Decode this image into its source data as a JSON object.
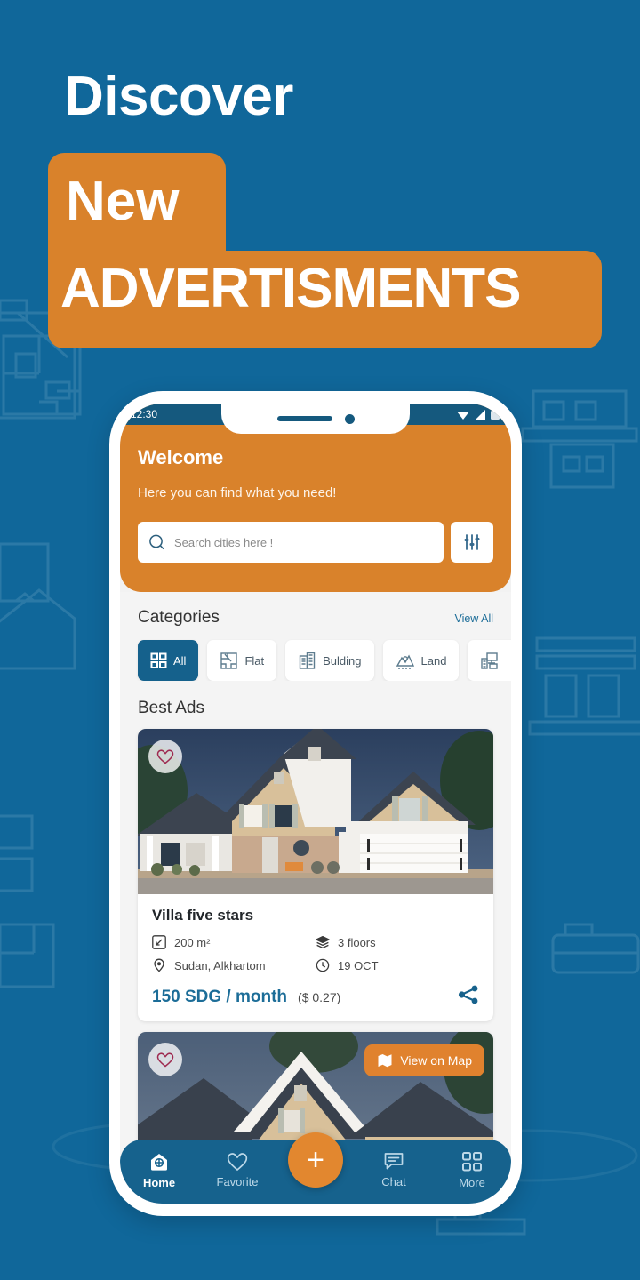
{
  "promo": {
    "line1": "Discover",
    "line2": "New",
    "line3": "ADVERTISMENTS",
    "accent_orange": "#d9822b",
    "background_blue": "#10679a"
  },
  "phone": {
    "statusbar": {
      "time": "12:30",
      "icons": [
        "wifi-icon",
        "signal-icon",
        "battery-icon"
      ]
    },
    "header": {
      "welcome": "Welcome",
      "subtitle": "Here you can find what you need!",
      "search_placeholder": "Search cities here !",
      "search_value": "",
      "search_icon": "search-icon",
      "filter_icon": "filter-sliders-icon"
    },
    "categories_section": {
      "title": "Categories",
      "view_all": "View All",
      "items": [
        {
          "label": "All",
          "icon": "grid-icon",
          "active": true
        },
        {
          "label": "Flat",
          "icon": "floorplan-icon",
          "active": false
        },
        {
          "label": "Bulding",
          "icon": "building-icon",
          "active": false
        },
        {
          "label": "Land",
          "icon": "land-pin-icon",
          "active": false
        },
        {
          "label": "",
          "icon": "office-icon",
          "active": false
        }
      ]
    },
    "ads_section": {
      "title": "Best Ads",
      "cards": [
        {
          "title": "Villa five stars",
          "area": "200 m²",
          "floors": "3 floors",
          "location": "Sudan, Alkhartom",
          "date": "19 OCT",
          "price": "150 SDG / month",
          "price_sub": "($ 0.27)",
          "favorite_icon": "heart-icon",
          "share_icon": "share-icon",
          "area_icon": "area-resize-icon",
          "floors_icon": "layers-icon",
          "location_icon": "map-pin-icon",
          "date_icon": "clock-icon"
        },
        {
          "title": "",
          "map_button": "View on Map",
          "map_icon": "map-folded-icon",
          "favorite_icon": "heart-icon"
        }
      ]
    },
    "bottom_nav": {
      "items": [
        {
          "label": "Home",
          "icon": "home-icon",
          "active": true
        },
        {
          "label": "Favorite",
          "icon": "heart-icon",
          "active": false
        },
        {
          "label": "Chat",
          "icon": "chat-icon",
          "active": false
        },
        {
          "label": "More",
          "icon": "grid-icon",
          "active": false
        }
      ],
      "fab": {
        "label": "+",
        "icon": "plus-icon"
      }
    }
  }
}
